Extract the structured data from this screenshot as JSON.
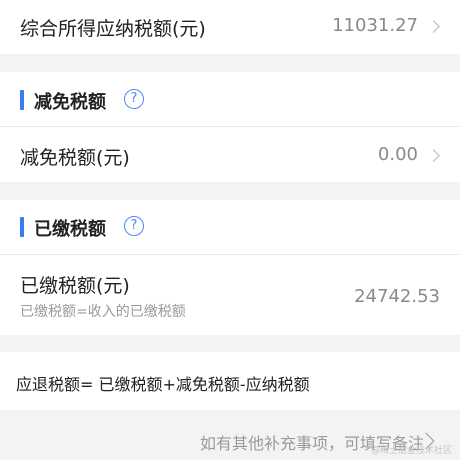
{
  "tax_payable": {
    "label": "综合所得应纳税额(元)",
    "value": "11031.27"
  },
  "reduction_section": {
    "title": "减免税额",
    "help_icon": "?",
    "row_label": "减免税额(元)",
    "row_value": "0.00"
  },
  "paid_section": {
    "title": "已缴税额",
    "help_icon": "?",
    "row_label": "已缴税额(元)",
    "row_sub": "已缴税额=收入的已缴税额",
    "row_value": "24742.53"
  },
  "formula": "应退税额= 已缴税额+减免税额-应纳税额",
  "remark_link": "如有其他补充事项，可填写备注",
  "watermark": "@稀土掘金技术社区",
  "colors": {
    "accent": "#3a7bf5",
    "background": "#f2f3f5"
  }
}
